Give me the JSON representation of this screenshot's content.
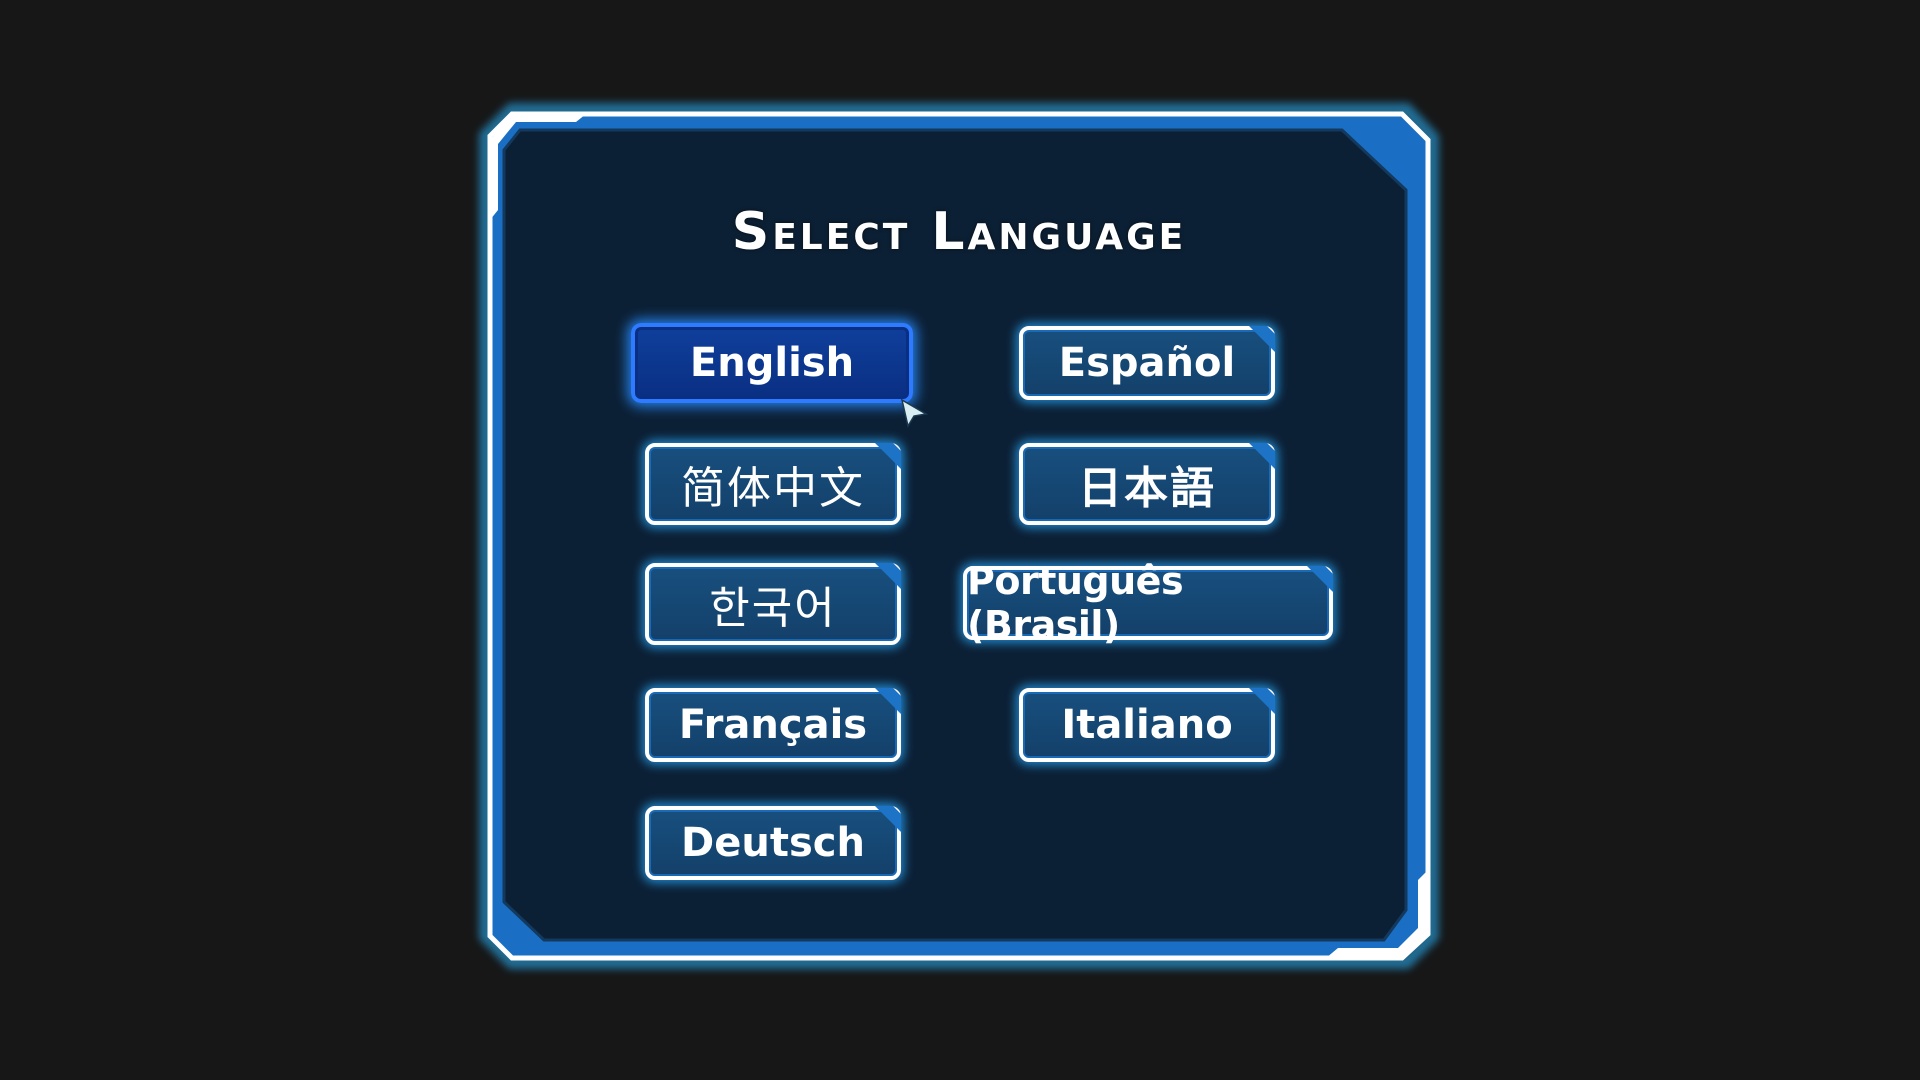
{
  "dialog": {
    "title": "Select Language"
  },
  "languages": {
    "english": "English",
    "espanol": "Español",
    "chinese_simplified": "简体中文",
    "japanese": "日本語",
    "korean": "한국어",
    "portuguese_brasil": "Português (Brasil)",
    "french": "Français",
    "italian": "Italiano",
    "german": "Deutsch"
  },
  "selected_language": "English",
  "icons": {
    "cursor": "arrow-cursor-icon"
  },
  "colors": {
    "background": "#171717",
    "panel": "#0c2035",
    "frame_glow": "#3fc4ff",
    "frame_accent": "#1d74c7",
    "button": "#184f7e",
    "button_selected": "#0f3f9c",
    "text": "#ffffff"
  }
}
